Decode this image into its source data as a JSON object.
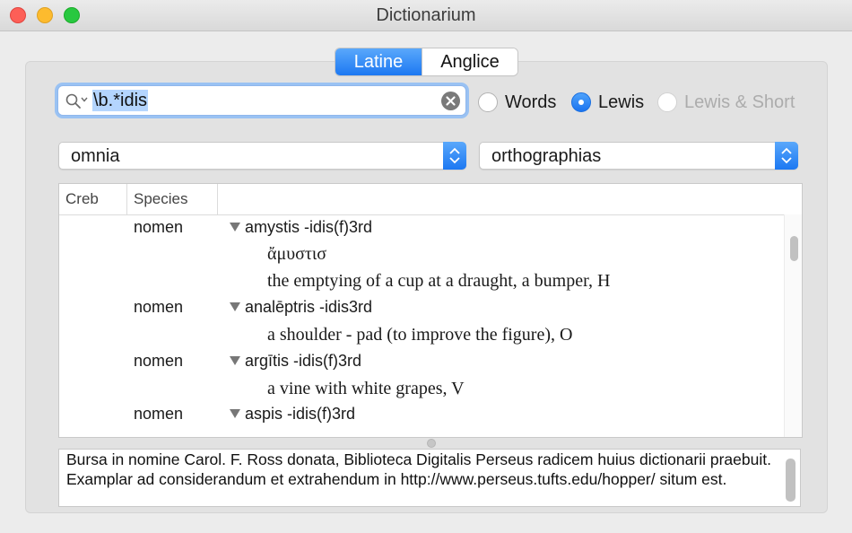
{
  "window": {
    "title": "Dictionarium"
  },
  "language_tabs": [
    {
      "label": "Latine",
      "selected": true
    },
    {
      "label": "Anglice",
      "selected": false
    }
  ],
  "search": {
    "value": "\\b.*idis"
  },
  "source_options": [
    {
      "label": "Words",
      "selected": false,
      "enabled": true
    },
    {
      "label": "Lewis",
      "selected": true,
      "enabled": true
    },
    {
      "label": "Lewis & Short",
      "selected": false,
      "enabled": false
    }
  ],
  "filters": {
    "left": "omnia",
    "right": "orthographias"
  },
  "table": {
    "columns": [
      "Creb",
      "Species"
    ],
    "rows": [
      {
        "species": "nomen",
        "entry": "amystis -idis(f)3rd",
        "greek": "ἄμυστισ",
        "definition": "the emptying of a cup at a draught, a bumper, H"
      },
      {
        "species": "nomen",
        "entry": "analēptris -idis3rd",
        "definition": "a shoulder - pad (to improve the figure), O"
      },
      {
        "species": "nomen",
        "entry": "argītis -idis(f)3rd",
        "definition": "a vine with white grapes, V"
      },
      {
        "species": "nomen",
        "entry": "aspis -idis(f)3rd"
      }
    ]
  },
  "footer": {
    "text": "Bursa in nomine Carol. F. Ross donata, Biblioteca Digitalis Perseus radicem huius dictionarii praebuit. Examplar ad considerandum et extrahendum in http://www.perseus.tufts.edu/hopper/ situm est."
  },
  "colors": {
    "accent": "#1c78f2",
    "selection": "#b4d5fe"
  }
}
